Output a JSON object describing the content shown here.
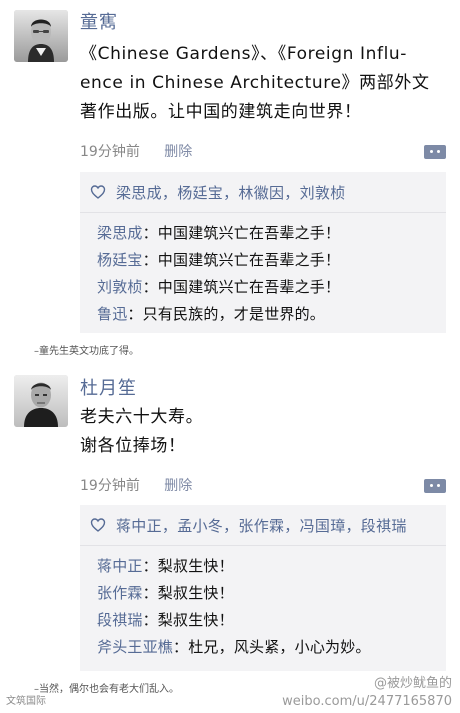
{
  "posts": [
    {
      "author": "童寯",
      "content_lines": [
        "《Chinese Gardens》、《Foreign Influ-",
        "ence in Chinese Architecture》两部外文",
        "著作出版。让中国的建筑走向世界！"
      ],
      "time": "19分钟前",
      "delete_label": "删除",
      "likes": "梁思成，杨廷宝，林徽因，刘敦桢",
      "comments": [
        {
          "author": "梁思成",
          "text": "：中国建筑兴亡在吾辈之手！"
        },
        {
          "author": "杨廷宝",
          "text": "：中国建筑兴亡在吾辈之手！"
        },
        {
          "author": "刘敦桢",
          "text": "：中国建筑兴亡在吾辈之手！"
        },
        {
          "author": "鲁迅",
          "text": "：只有民族的，才是世界的。"
        }
      ],
      "caption": "–童先生英文功底了得。"
    },
    {
      "author": "杜月笙",
      "content_lines": [
        "老夫六十大寿。",
        "谢各位捧场！"
      ],
      "time": "19分钟前",
      "delete_label": "删除",
      "likes": "蒋中正，孟小冬，张作霖，冯国璋，段祺瑞",
      "comments": [
        {
          "author": "蒋中正",
          "text": "：梨叔生快！"
        },
        {
          "author": "张作霖",
          "text": "：梨叔生快！"
        },
        {
          "author": "段祺瑞",
          "text": "：梨叔生快！"
        },
        {
          "author": "斧头王亚樵",
          "text": "：杜兄，风头紧，小心为妙。"
        }
      ],
      "caption": "–当然，偶尔也会有老大们乱入。"
    }
  ],
  "footer": {
    "logo_text": "文筑国际",
    "watermark_top": "@被炒鱿鱼的",
    "watermark_bottom": "weibo.com/u/2477165870"
  },
  "colors": {
    "name_blue": "#566b95",
    "meta_gray": "#888888",
    "box_bg": "#f3f3f5"
  },
  "icons": {
    "avatar_1": "portrait-photo-man-glasses",
    "avatar_2": "portrait-photo-man",
    "heart": "heart-outline-icon",
    "comment_button": "comment-menu-icon"
  }
}
